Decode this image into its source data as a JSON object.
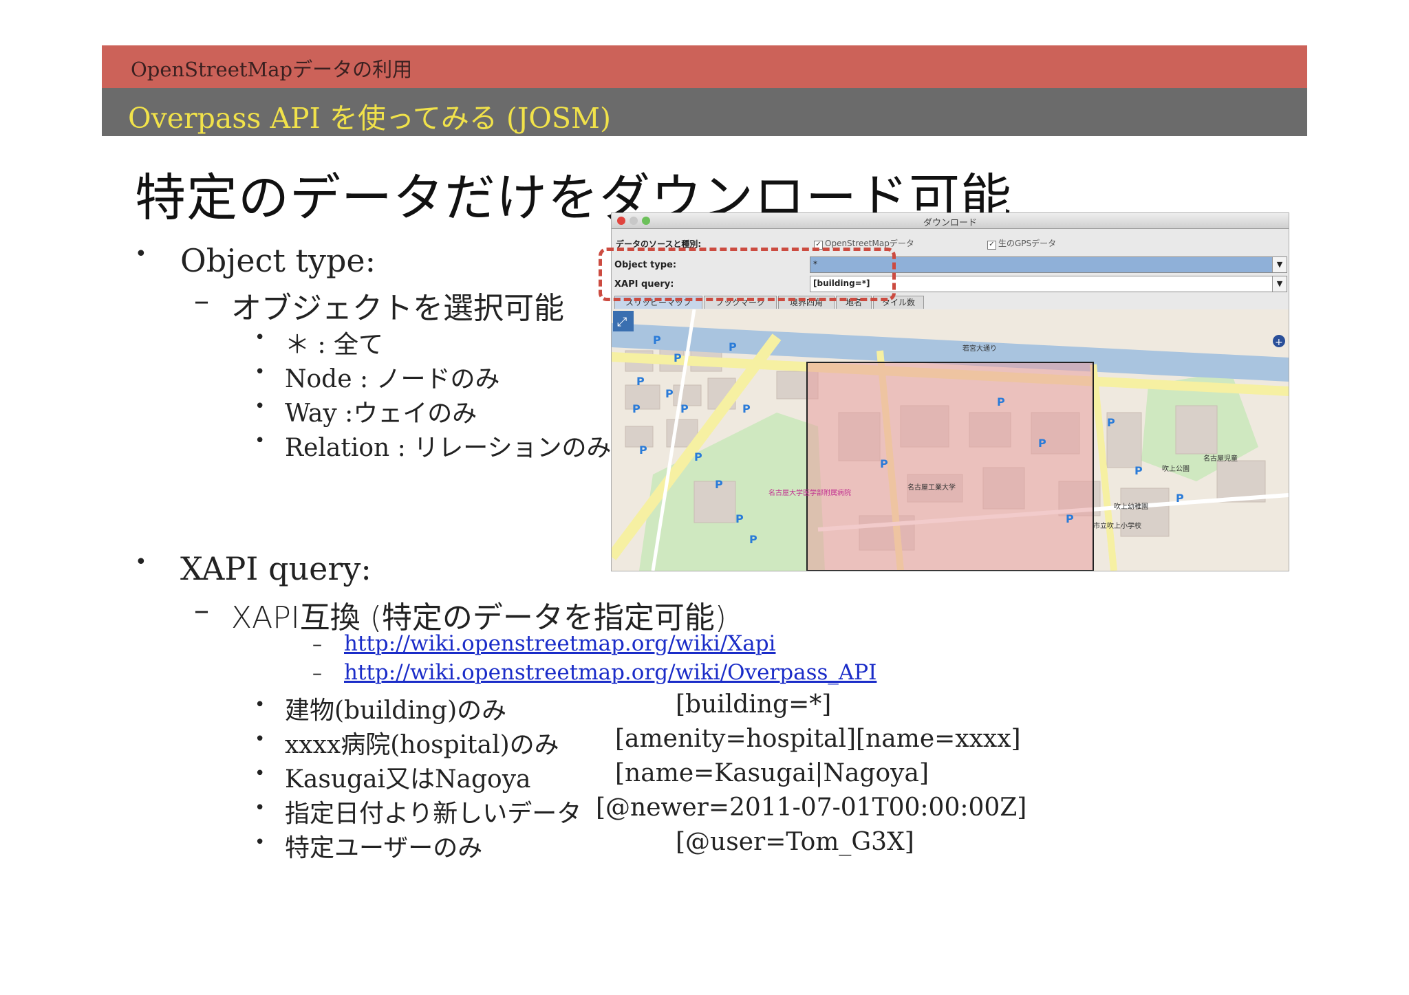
{
  "header": {
    "section": "OpenStreetMapデータの利用",
    "subtitle": "Overpass API を使ってみる (JOSM)"
  },
  "slide": {
    "heading": "特定のデータだけをダウンロード可能",
    "object_type": {
      "bullet": "Object type:",
      "sub": "オブジェクトを選択可能",
      "items": [
        "＊ : 全て",
        "Node : ノードのみ",
        "Way :ウェイのみ",
        "Relation : リレーションのみ"
      ]
    },
    "xapi": {
      "bullet": "XAPI query:",
      "sub": "XAPI互換 (特定のデータを指定可能)",
      "links": [
        "http://wiki.openstreetmap.org/wiki/Xapi",
        "http://wiki.openstreetmap.org/wiki/Overpass_API"
      ],
      "examples": [
        {
          "label": "建物(building)のみ",
          "query": "[building=*]"
        },
        {
          "label": "xxxx病院(hospital)のみ",
          "query": "[amenity=hospital][name=xxxx]"
        },
        {
          "label": "Kasugai又はNagoya",
          "query": "[name=Kasugai|Nagoya]"
        },
        {
          "label": "指定日付より新しいデータ",
          "query": "[@newer=2011-07-01T00:00:00Z]"
        },
        {
          "label": "特定ユーザーのみ",
          "query": "[@user=Tom_G3X]"
        }
      ]
    }
  },
  "dialog": {
    "title": "ダウンロード",
    "source_label": "データのソースと種別:",
    "checkbox_osm": "OpenStreetMapデータ",
    "checkbox_gps": "生のGPSデータ",
    "object_type_label": "Object type:",
    "object_type_value": "*",
    "xapi_label": "XAPI query:",
    "xapi_value": "[building=*]",
    "tabs": [
      "スリッピーマップ",
      "ブックマーク",
      "境界四角",
      "地名",
      "タイル数"
    ],
    "map_labels": [
      "若宮大通り",
      "名古屋大学医学部附属病院",
      "名古屋工業大学",
      "吹上公園",
      "吹上幼稚園",
      "市立吹上小学校",
      "名古屋児童"
    ],
    "colors": {
      "highlight": "#cc4b40",
      "selection": "#e8a0a0",
      "combo_selected": "#8fb0d8"
    }
  }
}
